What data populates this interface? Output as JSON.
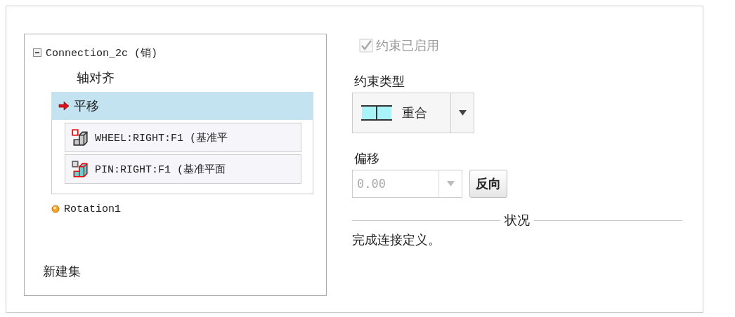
{
  "tree": {
    "root": {
      "label": "Connection_2c (销)",
      "expanded": true,
      "children": [
        {
          "label": "轴对齐",
          "selected": false,
          "current": false
        },
        {
          "label": "平移",
          "selected": true,
          "current": true,
          "references": [
            {
              "label": "WHEEL:RIGHT:F1 (基准平",
              "kind": "square"
            },
            {
              "label": "PIN:RIGHT:F1 (基准平面",
              "kind": "block"
            }
          ]
        }
      ]
    },
    "sets": [
      {
        "label": "Rotation1"
      }
    ],
    "new_set": "新建集"
  },
  "constraint_enabled": {
    "label": "约束已启用",
    "checked": true,
    "disabled": true
  },
  "constraint_type": {
    "label": "约束类型",
    "value": "重合"
  },
  "offset": {
    "label": "偏移",
    "value": "0.00",
    "disabled": true,
    "button": "反向"
  },
  "status": {
    "title": "状况",
    "message": "完成连接定义。"
  }
}
